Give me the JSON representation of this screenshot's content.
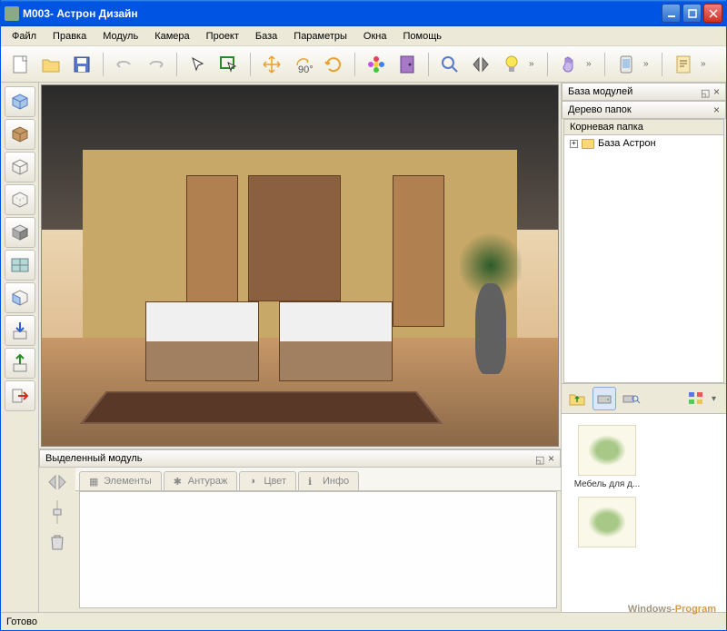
{
  "window": {
    "title": "М003- Астрон Дизайн"
  },
  "menu": {
    "file": "Файл",
    "edit": "Правка",
    "module": "Модуль",
    "camera": "Камера",
    "project": "Проект",
    "base": "База",
    "params": "Параметры",
    "windows": "Окна",
    "help": "Помощь"
  },
  "panels": {
    "selected_module": "Выделенный модуль",
    "module_base": "База модулей",
    "folder_tree": "Дерево папок"
  },
  "tabs": {
    "elements": "Элементы",
    "entourage": "Антураж",
    "color": "Цвет",
    "info": "Инфо"
  },
  "tree": {
    "root": "Корневая папка",
    "items": [
      {
        "label": "База Астрон"
      }
    ]
  },
  "thumbs": [
    {
      "label": "Мебель для д..."
    },
    {
      "label": ""
    }
  ],
  "status": "Готово",
  "watermark": {
    "a": "Windows-",
    "b": "Program"
  }
}
